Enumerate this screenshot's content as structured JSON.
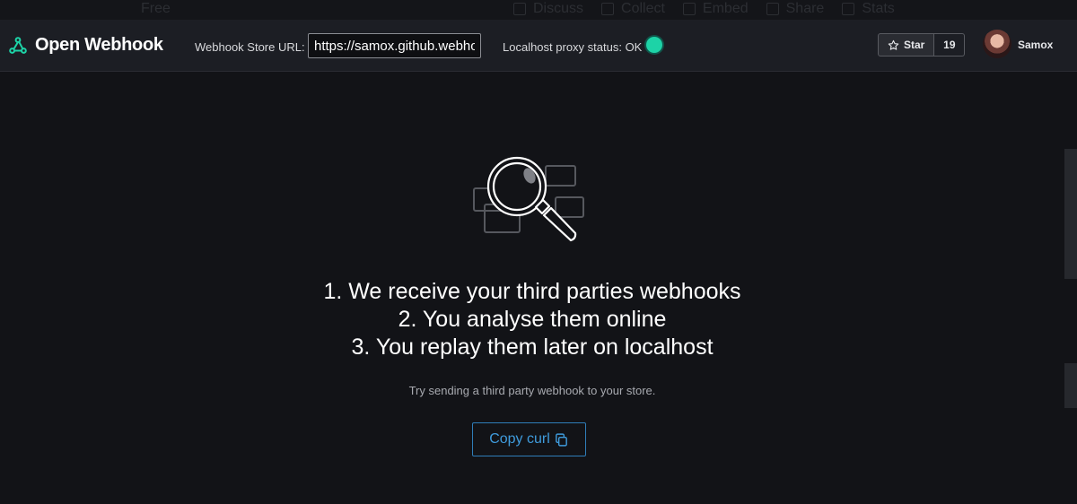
{
  "background_toolbar": {
    "left_label": "Free",
    "items": [
      "Discuss",
      "Collect",
      "Embed",
      "Share",
      "Stats"
    ]
  },
  "navbar": {
    "brand": "Open Webhook",
    "store_url_label": "Webhook Store URL:",
    "store_url_value": "https://samox.github.webhook",
    "proxy_status_label": "Localhost proxy status: OK",
    "proxy_status_color": "#1dd3a7",
    "github": {
      "star_label": "Star",
      "star_count": "19"
    },
    "user": {
      "name": "Samox"
    }
  },
  "main": {
    "icon": "magnifier-over-cards-icon",
    "steps": [
      "1. We receive your third parties webhooks",
      "2. You analyse them online",
      "3. You replay them later on localhost"
    ],
    "hint": "Try sending a third party webhook to your store.",
    "copy_button_label": "Copy curl"
  },
  "colors": {
    "background": "#121317",
    "navbar": "#1c1e24",
    "accent": "#3f9bdc"
  }
}
